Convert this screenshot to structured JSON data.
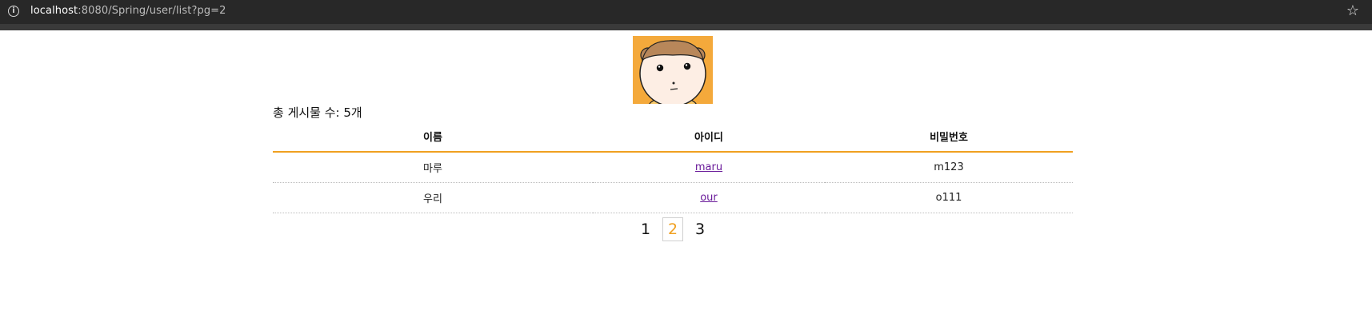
{
  "browser": {
    "url_host": "localhost",
    "url_rest": ":8080/Spring/user/list?pg=2"
  },
  "total": {
    "label": "총 게시물 수: 5개"
  },
  "table": {
    "headers": [
      "이름",
      "아이디",
      "비밀번호"
    ],
    "rows": [
      {
        "name": "마루",
        "id": "maru",
        "password": "m123"
      },
      {
        "name": "우리",
        "id": "our",
        "password": "o111"
      }
    ]
  },
  "pagination": {
    "pages": [
      "1",
      "2",
      "3"
    ],
    "current": "2"
  },
  "colors": {
    "accent": "#f0a020",
    "avatar_bg": "#f4a93b",
    "link": "#6a1b9a"
  },
  "icons": [
    "info-icon",
    "star-icon",
    "avatar"
  ]
}
